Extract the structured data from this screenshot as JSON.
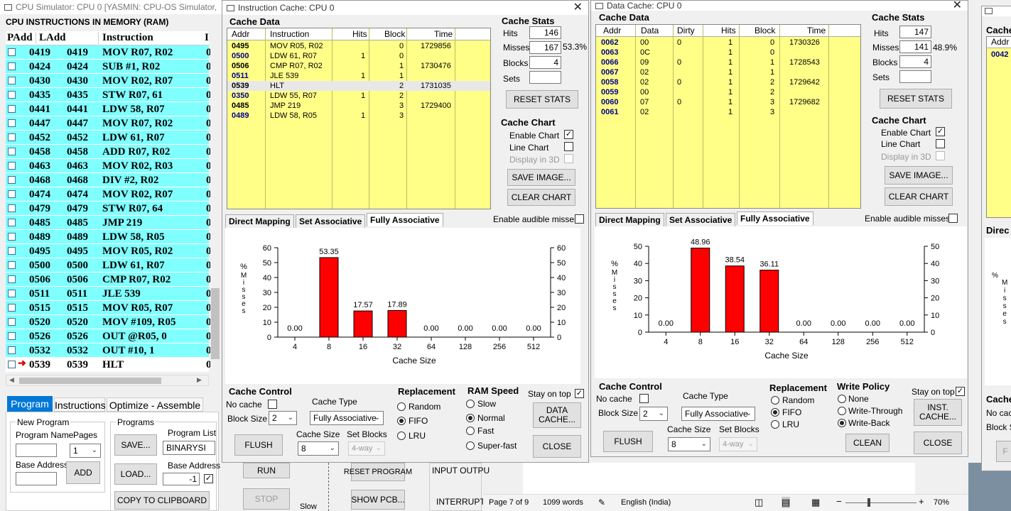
{
  "main": {
    "title": "CPU Simulator: CPU 0     [YASMIN: CPU-OS Simulator,",
    "ram_title": "CPU INSTRUCTIONS IN MEMORY (RAM)",
    "headers": [
      "PAdd",
      "LAdd",
      "Instruction",
      "I"
    ],
    "rows": [
      {
        "p": "0419",
        "l": "0419",
        "i": "MOV R07, R02",
        "x": "0"
      },
      {
        "p": "0424",
        "l": "0424",
        "i": "SUB #1, R02",
        "x": "0"
      },
      {
        "p": "0430",
        "l": "0430",
        "i": "MOV R02, R07",
        "x": "0"
      },
      {
        "p": "0435",
        "l": "0435",
        "i": "STW R07, 61",
        "x": "0"
      },
      {
        "p": "0441",
        "l": "0441",
        "i": "LDW 58, R07",
        "x": "0"
      },
      {
        "p": "0447",
        "l": "0447",
        "i": "MOV R07, R02",
        "x": "0"
      },
      {
        "p": "0452",
        "l": "0452",
        "i": "LDW 61, R07",
        "x": "0"
      },
      {
        "p": "0458",
        "l": "0458",
        "i": "ADD R07, R02",
        "x": "0"
      },
      {
        "p": "0463",
        "l": "0463",
        "i": "MOV R02, R03",
        "x": "0"
      },
      {
        "p": "0468",
        "l": "0468",
        "i": "DIV #2, R02",
        "x": "0"
      },
      {
        "p": "0474",
        "l": "0474",
        "i": "MOV R02, R07",
        "x": "0"
      },
      {
        "p": "0479",
        "l": "0479",
        "i": "STW R07, 64",
        "x": "0"
      },
      {
        "p": "0485",
        "l": "0485",
        "i": "JMP 219",
        "x": "0"
      },
      {
        "p": "0489",
        "l": "0489",
        "i": "LDW 58, R05",
        "x": "0"
      },
      {
        "p": "0495",
        "l": "0495",
        "i": "MOV R05, R02",
        "x": "0"
      },
      {
        "p": "0500",
        "l": "0500",
        "i": "LDW 61, R07",
        "x": "0"
      },
      {
        "p": "0506",
        "l": "0506",
        "i": "CMP R07, R02",
        "x": "0"
      },
      {
        "p": "0511",
        "l": "0511",
        "i": "JLE 539",
        "x": "0"
      },
      {
        "p": "0515",
        "l": "0515",
        "i": "MOV R05, R07",
        "x": "0"
      },
      {
        "p": "0520",
        "l": "0520",
        "i": "MOV #109, R05",
        "x": "0"
      },
      {
        "p": "0526",
        "l": "0526",
        "i": "OUT @R05, 0",
        "x": "0"
      },
      {
        "p": "0532",
        "l": "0532",
        "i": "OUT #10, 1",
        "x": "0"
      },
      {
        "p": "0539",
        "l": "0539",
        "i": "HLT",
        "x": "0"
      }
    ],
    "tabs": [
      "Program",
      "Instructions",
      "Optimize - Assemble"
    ],
    "new_program": "New Program",
    "program_name": "Program Name",
    "pages": "Pages",
    "pages_value": "1",
    "base_address": "Base Address",
    "add": "ADD",
    "programs": "Programs",
    "program_list": "Program List",
    "program_list_value": "BINARYSI",
    "save": "SAVE...",
    "load": "LOAD...",
    "base_address2": "Base Address",
    "base_value": "-1",
    "copy": "COPY TO CLIPBOARD"
  },
  "behind": {
    "run": "RUN",
    "stop": "STOP",
    "slow": "Slow",
    "reset_program": "RESET PROGRAM",
    "show_pcb": "SHOW PCB...",
    "input_output": "INPUT OUTPU",
    "interrupt": "INTERRUPT",
    "status_page": "Page 7 of 9",
    "status_words": "1099 words",
    "status_lang": "English (India)",
    "status_zoom": "70%"
  },
  "icache": {
    "title": "Instruction Cache: CPU 0",
    "cache_data": "Cache Data",
    "headers": [
      "Addr",
      "Instruction",
      "Hits",
      "Block",
      "Time"
    ],
    "rows": [
      {
        "addr": "0495",
        "ins": "MOV R05, R02",
        "hits": "",
        "block": "0",
        "time": "1729856",
        "hl": false,
        "bold": true
      },
      {
        "addr": "0500",
        "ins": "LDW 61, R07",
        "hits": "1",
        "block": "0",
        "time": "",
        "hl": false,
        "bold": false
      },
      {
        "addr": "0506",
        "ins": "CMP R07, R02",
        "hits": "",
        "block": "1",
        "time": "1730476",
        "hl": false,
        "bold": true
      },
      {
        "addr": "0511",
        "ins": "JLE 539",
        "hits": "1",
        "block": "1",
        "time": "",
        "hl": false,
        "bold": false
      },
      {
        "addr": "0539",
        "ins": "HLT",
        "hits": "",
        "block": "2",
        "time": "1731035",
        "hl": true,
        "bold": true
      },
      {
        "addr": "0350",
        "ins": "LDW 55, R07",
        "hits": "1",
        "block": "2",
        "time": "",
        "hl": false,
        "bold": false
      },
      {
        "addr": "0485",
        "ins": "JMP 219",
        "hits": "",
        "block": "3",
        "time": "1729400",
        "hl": false,
        "bold": true
      },
      {
        "addr": "0489",
        "ins": "LDW 58, R05",
        "hits": "1",
        "block": "3",
        "time": "",
        "hl": false,
        "bold": false
      }
    ],
    "stats": "Cache Stats",
    "hits_label": "Hits",
    "hits": "146",
    "misses_label": "Misses",
    "misses": "167",
    "miss_pct": "53.3%",
    "blocks_label": "Blocks",
    "blocks": "4",
    "sets_label": "Sets",
    "sets": "",
    "reset": "RESET STATS",
    "chart_label": "Cache Chart",
    "enable_chart": "Enable Chart",
    "line_chart": "Line Chart",
    "display3d": "Display in 3D",
    "save_image": "SAVE IMAGE...",
    "clear_chart": "CLEAR CHART",
    "tabs": [
      "Direct Mapping",
      "Set Associative",
      "Fully Associative"
    ],
    "audible": "Enable audible misses",
    "control": "Cache Control",
    "no_cache": "No cache",
    "block_size": "Block Size",
    "block_size_value": "2",
    "cache_type": "Cache Type",
    "cache_type_value": "Fully Associative",
    "cache_size": "Cache Size",
    "cache_size_value": "8",
    "set_blocks": "Set Blocks",
    "set_blocks_value": "4-way",
    "flush": "FLUSH",
    "replacement": "Replacement",
    "repl": [
      "Random",
      "FIFO",
      "LRU"
    ],
    "ram_speed": "RAM Speed",
    "speeds": [
      "Slow",
      "Normal",
      "Fast",
      "Super-fast"
    ],
    "stay": "Stay on top",
    "other_cache": "DATA CACHE...",
    "close": "CLOSE"
  },
  "dcache": {
    "title": "Data Cache: CPU 0",
    "cache_data": "Cache Data",
    "headers": [
      "Addr",
      "Data",
      "Dirty",
      "Hits",
      "Block",
      "Time"
    ],
    "rows": [
      {
        "addr": "0062",
        "data": "00",
        "dirty": "0",
        "hits": "1",
        "block": "0",
        "time": "1730326"
      },
      {
        "addr": "0063",
        "data": "0C",
        "dirty": "",
        "hits": "1",
        "block": "0",
        "time": ""
      },
      {
        "addr": "0066",
        "data": "09",
        "dirty": "0",
        "hits": "1",
        "block": "1",
        "time": "1728543"
      },
      {
        "addr": "0067",
        "data": "02",
        "dirty": "",
        "hits": "1",
        "block": "1",
        "time": ""
      },
      {
        "addr": "0058",
        "data": "02",
        "dirty": "0",
        "hits": "1",
        "block": "2",
        "time": "1729642"
      },
      {
        "addr": "0059",
        "data": "00",
        "dirty": "",
        "hits": "1",
        "block": "2",
        "time": ""
      },
      {
        "addr": "0060",
        "data": "07",
        "dirty": "0",
        "hits": "1",
        "block": "3",
        "time": "1729682"
      },
      {
        "addr": "0061",
        "data": "02",
        "dirty": "",
        "hits": "1",
        "block": "3",
        "time": ""
      }
    ],
    "stats": "Cache Stats",
    "hits_label": "Hits",
    "hits": "147",
    "misses_label": "Misses",
    "misses": "141",
    "miss_pct": "48.9%",
    "blocks_label": "Blocks",
    "blocks": "4",
    "sets_label": "Sets",
    "sets": "",
    "reset": "RESET STATS",
    "chart_label": "Cache Chart",
    "enable_chart": "Enable Chart",
    "line_chart": "Line Chart",
    "display3d": "Display in 3D",
    "save_image": "SAVE IMAGE...",
    "clear_chart": "CLEAR CHART",
    "tabs": [
      "Direct Mapping",
      "Set Associative",
      "Fully Associative"
    ],
    "audible": "Enable audible misses",
    "control": "Cache Control",
    "no_cache": "No cache",
    "block_size": "Block Size",
    "block_size_value": "2",
    "cache_type": "Cache Type",
    "cache_type_value": "Fully Associative",
    "cache_size": "Cache Size",
    "cache_size_value": "8",
    "set_blocks": "Set Blocks",
    "set_blocks_value": "4-way",
    "flush": "FLUSH",
    "replacement": "Replacement",
    "repl": [
      "Random",
      "FIFO",
      "LRU"
    ],
    "write_policy": "Write Policy",
    "policies": [
      "None",
      "Write-Through",
      "Write-Back"
    ],
    "stay": "Stay on top",
    "other_cache": "INST. CACHE...",
    "clean": "CLEAN",
    "close": "CLOSE"
  },
  "partial": {
    "cache": "Cache",
    "addr": "Addr",
    "row": "0042",
    "direct": "Direc",
    "pct": "%",
    "y_letters": [
      "M",
      "i",
      "s",
      "s",
      "e",
      "s"
    ],
    "cache2": "Cache",
    "no_cache": "No cac",
    "block": "Block S"
  },
  "chart_data": [
    {
      "type": "bar",
      "categories": [
        "4",
        "8",
        "16",
        "32",
        "64",
        "128",
        "256",
        "512"
      ],
      "values": [
        0.0,
        53.35,
        17.57,
        17.89,
        0.0,
        0.0,
        0.0,
        0.0
      ],
      "labels": [
        "0.00",
        "53.35",
        "17.57",
        "17.89",
        "0.00",
        "0.00",
        "0.00",
        "0.00"
      ],
      "xlabel": "Cache Size",
      "ylabel": "% Misses",
      "ylim": [
        0,
        60
      ],
      "yticks": [
        0,
        10,
        20,
        30,
        40,
        50,
        60
      ],
      "bar_color": "#ff0000"
    },
    {
      "type": "bar",
      "categories": [
        "4",
        "8",
        "16",
        "32",
        "64",
        "128",
        "256",
        "512"
      ],
      "values": [
        0.0,
        48.96,
        38.54,
        36.11,
        0.0,
        0.0,
        0.0,
        0.0
      ],
      "labels": [
        "0.00",
        "48.96",
        "38.54",
        "36.11",
        "0.00",
        "0.00",
        "0.00",
        "0.00"
      ],
      "xlabel": "Cache Size",
      "ylabel": "% Misses",
      "ylim": [
        0,
        50
      ],
      "yticks": [
        0,
        10,
        20,
        30,
        40,
        50
      ],
      "bar_color": "#ff0000"
    }
  ]
}
